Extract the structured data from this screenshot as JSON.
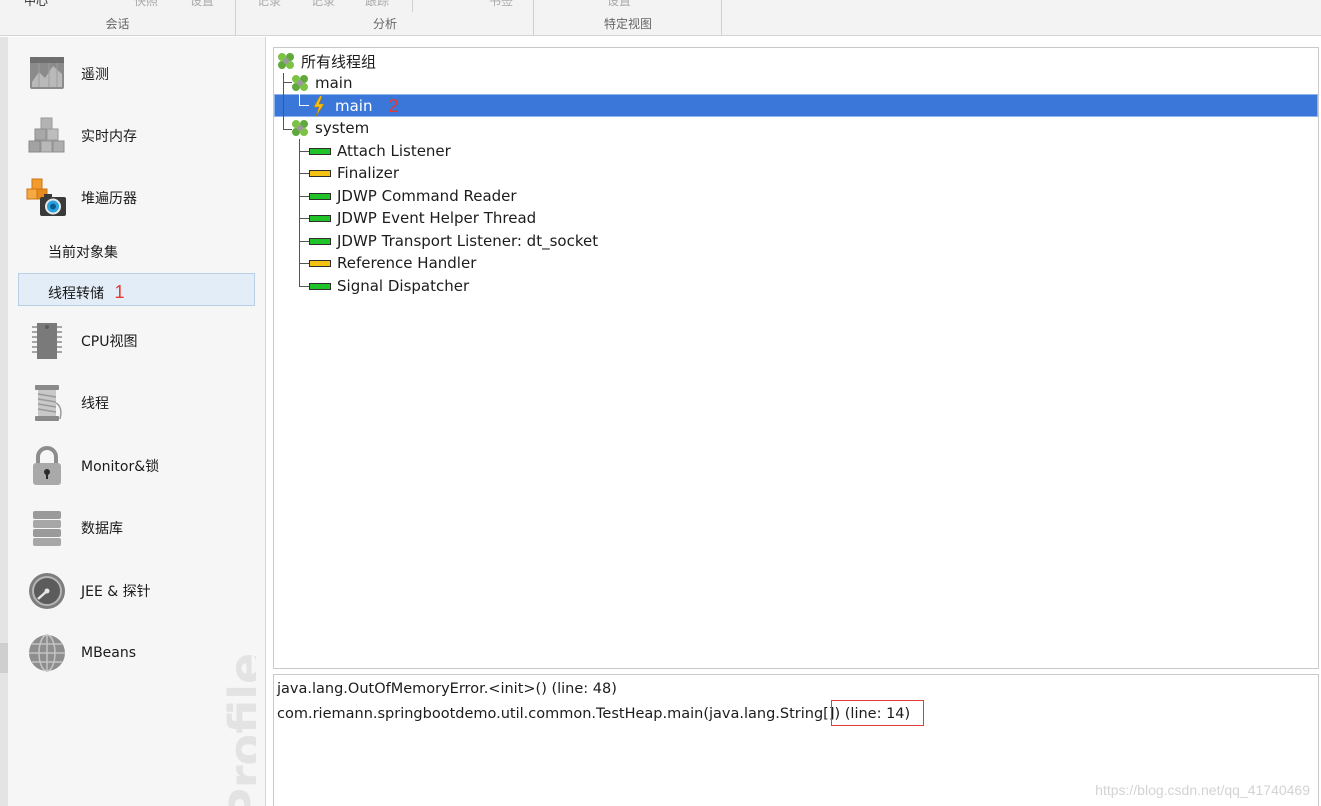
{
  "ribbon": {
    "groups": [
      {
        "title": "会话",
        "items": [
          "中心",
          "快照",
          "设置"
        ]
      },
      {
        "title": "分析",
        "items": [
          "记录",
          "记录",
          "跟踪",
          "书签"
        ]
      },
      {
        "title": "特定视图",
        "items": [
          "设置"
        ]
      }
    ]
  },
  "sidebar": {
    "items": [
      {
        "label": "遥测",
        "icon": "telemetry-icon"
      },
      {
        "label": "实时内存",
        "icon": "live-memory-icon"
      },
      {
        "label": "堆遍历器",
        "icon": "heap-walker-icon"
      },
      {
        "label": "CPU视图",
        "icon": "cpu-icon"
      },
      {
        "label": "线程",
        "icon": "threads-icon"
      },
      {
        "label": "Monitor&锁",
        "icon": "lock-icon"
      },
      {
        "label": "数据库",
        "icon": "database-icon"
      },
      {
        "label": "JEE & 探针",
        "icon": "gauge-icon"
      },
      {
        "label": "MBeans",
        "icon": "globe-icon"
      }
    ],
    "subitems": [
      {
        "label": "当前对象集",
        "selected": false
      },
      {
        "label": "线程转储",
        "selected": true,
        "marker": "1"
      }
    ],
    "watermark": "Profiler"
  },
  "tree": {
    "root": "所有线程组",
    "group_main": "main",
    "thread_main": "main",
    "thread_main_marker": "2",
    "group_system": "system",
    "system_threads": [
      {
        "name": "Attach Listener",
        "state": "green"
      },
      {
        "name": "Finalizer",
        "state": "yellow"
      },
      {
        "name": "JDWP Command Reader",
        "state": "green"
      },
      {
        "name": "JDWP Event Helper Thread",
        "state": "green"
      },
      {
        "name": "JDWP Transport Listener: dt_socket",
        "state": "green"
      },
      {
        "name": "Reference Handler",
        "state": "yellow"
      },
      {
        "name": "Signal Dispatcher",
        "state": "green"
      }
    ]
  },
  "stack": {
    "lines": [
      "java.lang.OutOfMemoryError.<init>() (line: 48)",
      "com.riemann.springbootdemo.util.common.TestHeap.main(java.lang.String[]) (line: 14)"
    ],
    "url_watermark": "https://blog.csdn.net/qq_41740469"
  },
  "colors": {
    "selection": "#3a77d8",
    "marker_red": "#e8392f",
    "running_green": "#20c42a",
    "waiting_yellow": "#f6c117"
  }
}
